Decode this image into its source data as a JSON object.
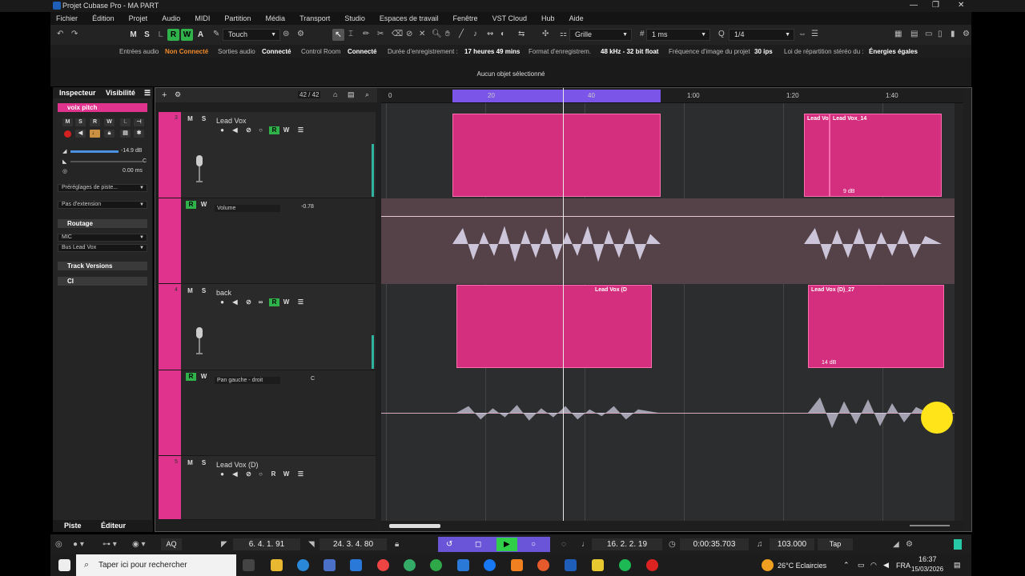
{
  "window": {
    "title": "Projet Cubase Pro - MA PART"
  },
  "menu": [
    "Fichier",
    "Édition",
    "Projet",
    "Audio",
    "MIDI",
    "Partition",
    "Média",
    "Transport",
    "Studio",
    "Espaces de travail",
    "Fenêtre",
    "VST Cloud",
    "Hub",
    "Aide"
  ],
  "toolbar": {
    "btn_m": "M",
    "btn_s": "S",
    "btn_l": "L",
    "btn_r": "R",
    "btn_w": "W",
    "btn_a": "A",
    "automation_mode": "Touch",
    "snap_type": "Grille",
    "grid_value": "1 ms",
    "quantize": "1/4"
  },
  "status": {
    "audio_in_label": "Entrées audio",
    "audio_in_value": "Non Connecté",
    "audio_out_label": "Sorties audio",
    "audio_out_value": "Connecté",
    "control_room_label": "Control Room",
    "control_room_value": "Connecté",
    "rec_time_label": "Durée d'enregistrement :",
    "rec_time_value": "17 heures 49 mins",
    "rec_format_label": "Format d'enregistrem.",
    "rec_format_value": "48 kHz - 32 bit float",
    "framerate_label": "Fréquence d'image du projet",
    "framerate_value": "30 ips",
    "pan_law_label": "Loi de répartition stéréo du :",
    "pan_law_value": "Énergies égales"
  },
  "info_line": "Aucun objet sélectionné",
  "inspector": {
    "tab_inspector": "Inspecteur",
    "tab_visibility": "Visibilité",
    "track_name": "voix pitch",
    "volume": "-14.9 dB",
    "pan": "C",
    "delay": "0.00 ms",
    "presets": "Préréglages de piste...",
    "extension": "Pas d'extension",
    "routing_header": "Routage",
    "input": "MIC",
    "output": "Bus Lead Vox",
    "track_versions": "Track Versions",
    "ci": "CI",
    "bottom_tab_track": "Piste",
    "bottom_tab_editor": "Éditeur"
  },
  "project": {
    "track_count": "42 / 42",
    "tracks": [
      {
        "num": "3",
        "name": "Lead Vox"
      },
      {
        "num": "4",
        "name": "back"
      },
      {
        "num": "5",
        "name": "Lead Vox (D)"
      }
    ],
    "lanes": [
      {
        "param": "Volume",
        "value": "-0.78"
      },
      {
        "param": "Pan gauche - droit",
        "value": "C"
      }
    ],
    "ruler": [
      "0",
      "20",
      "40",
      "1:00",
      "1:20",
      "1:40"
    ],
    "events": {
      "ev1_label": "Lead Vo",
      "ev2_label": "Lead Vox_14",
      "ev2_db": "9 dB",
      "ev3_label": "Lead Vox (D",
      "ev4_label": "Lead Vox (D)_27",
      "ev4_db": "14 dB"
    }
  },
  "transport": {
    "left_locator": "6. 4. 1. 91",
    "right_locator": "24. 3. 4. 80",
    "position_bars": "16. 2. 2. 19",
    "position_time": "0:00:35.703",
    "tempo": "103.000",
    "tap": "Tap",
    "aq": "AQ"
  },
  "taskbar": {
    "search_placeholder": "Taper ici pour rechercher",
    "weather": "26°C  Eclaircies",
    "time": "16:37",
    "date": "15/03/2026"
  },
  "colors": {
    "event": "#d42e7e",
    "cycle": "#7b55e8",
    "accent_green": "#2fb24a",
    "warn": "#f28a2a"
  }
}
